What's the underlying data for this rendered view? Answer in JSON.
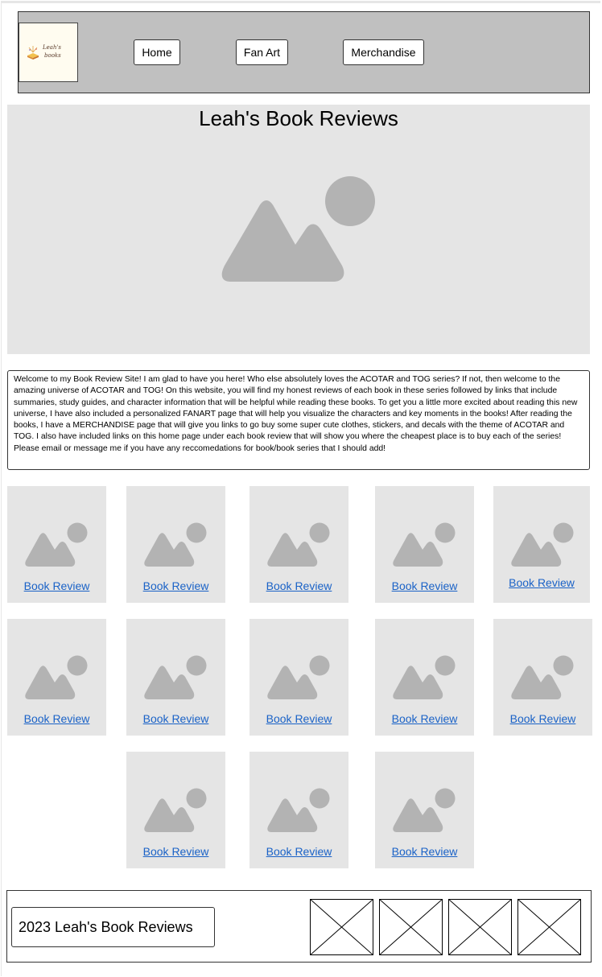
{
  "header": {
    "logo_text": [
      "Leah's",
      "books"
    ],
    "nav": [
      "Home",
      "Fan Art",
      "Merchandise"
    ]
  },
  "hero": {
    "title": "Leah's Book Reviews"
  },
  "welcome": {
    "text": "Welcome to my Book Review Site! I am glad to have you here! Who else absolutely loves the ACOTAR and TOG series? If not, then welcome to the amazing universe of ACOTAR and TOG! On this website, you will find my honest reviews of each book in these series followed by links that include summaries, study guides, and character information that will be helpful while reading these books. To get you a little more excited about reading this new universe, I have also included a personalized FANART page that will help you visualize the characters and key moments in the books! After reading the books, I have a MERCHANDISE page that will give you links to go buy some super cute clothes, stickers, and decals with the theme of ACOTAR and TOG. I also have included links on this home page under each book review that will show you where the cheapest place is to buy each of the series! Please email or message me if you have any reccomedations for book/book series that I should add!"
  },
  "reviews": {
    "link_label": "Book Review",
    "count": 13
  },
  "footer": {
    "copyright": "2023 Leah's Book Reviews",
    "social_icons": [
      "placeholder-image-icon",
      "placeholder-image-icon",
      "placeholder-image-icon",
      "placeholder-image-icon"
    ]
  },
  "colors": {
    "header_bg": "#c0c0c0",
    "panel_bg": "#e5e5e5",
    "placeholder_fill": "#b3b3b3",
    "link": "#1a62c7"
  }
}
